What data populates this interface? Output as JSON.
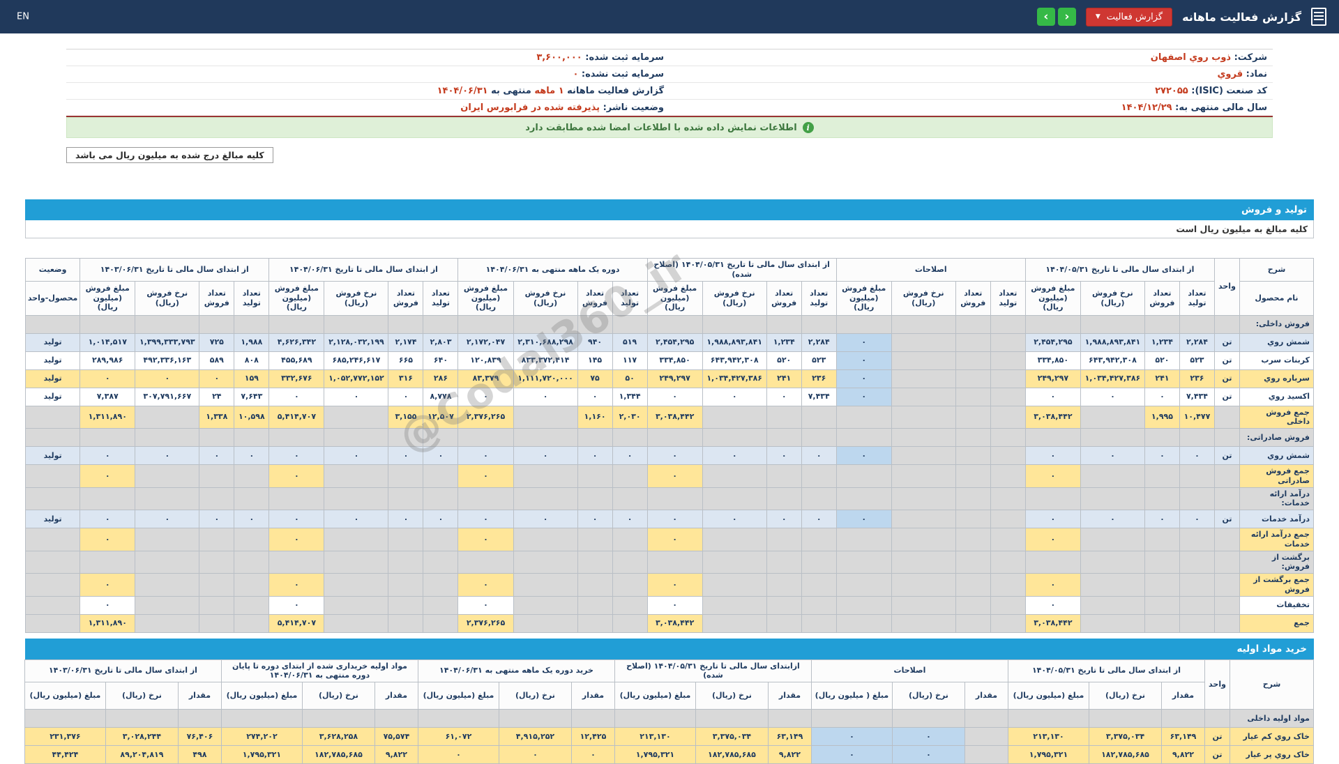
{
  "top_bar": {
    "title": "گزارش فعالیت ماهانه",
    "report_button_label": "گزارش فعالیت",
    "lang_toggle": "EN"
  },
  "info_banner": {
    "text": "اطلاعات نمایش داده شده با اطلاعات امضا شده مطابقت دارد",
    "icon": "info-circle"
  },
  "amounts_note_box": "کلیه مبالغ درج شده به میلیون ریال می باشد",
  "watermark": "@Codal360_ir",
  "colors": {
    "topbar": "#20395b",
    "accent_blue": "#219ed6",
    "accent_red": "#c43b1e",
    "row_blue": "#dce6f2",
    "row_yellow": "#ffe699",
    "row_gray": "#d9d9d9",
    "adjust_cell": "#bdd7ee",
    "success_bg": "#dff0d8",
    "button_red": "#cf3732",
    "button_green": "#35b947"
  },
  "company": {
    "rows": [
      {
        "right": [
          {
            "t": "شرکت: ",
            "c": "lbl"
          },
          {
            "t": "ذوب روي اصفهان",
            "c": "red"
          }
        ],
        "left": [
          {
            "t": "سرمایه ثبت شده: ",
            "c": "lbl"
          },
          {
            "t": "۳,۶۰۰,۰۰۰",
            "c": "red"
          }
        ]
      },
      {
        "right": [
          {
            "t": "نماد: ",
            "c": "lbl"
          },
          {
            "t": "قروي",
            "c": "red"
          }
        ],
        "left": [
          {
            "t": "سرمایه ثبت نشده: ",
            "c": "lbl"
          },
          {
            "t": "۰",
            "c": "red"
          }
        ]
      },
      {
        "right": [
          {
            "t": "کد صنعت (ISIC): ",
            "c": "lbl"
          },
          {
            "t": "۲۷۲۰۵۵",
            "c": "red"
          }
        ],
        "left": [
          {
            "t": "گزارش فعالیت ماهانه ",
            "c": "lbl"
          },
          {
            "t": "۱ ماهه",
            "c": "red"
          },
          {
            "t": " منتهی به ",
            "c": "lbl"
          },
          {
            "t": "۱۴۰۴/۰۶/۳۱",
            "c": "red"
          }
        ]
      },
      {
        "right": [
          {
            "t": "سال مالی منتهی به: ",
            "c": "lbl"
          },
          {
            "t": "۱۴۰۴/۱۲/۲۹",
            "c": "red"
          }
        ],
        "left": [
          {
            "t": "وضعیت ناشر: ",
            "c": "lbl"
          },
          {
            "t": "پذیرفته شده در فرابورس ایران",
            "c": "red"
          }
        ]
      }
    ]
  },
  "tables": [
    {
      "id": "production-sales",
      "bar_label": "تولید و فروش",
      "note": "کلیه مبالغ به میلیون ریال است",
      "header": {
        "sharh_top": "شرح",
        "sharh_sub": "نام محصول",
        "unit": "واحد",
        "status_top": "وضعیت",
        "status_sub": "محصول-واحد",
        "groups": [
          {
            "label": "از ابتدای سال مالی تا تاریخ ۱۴۰۴/۰۵/۳۱",
            "cols": [
              "تعداد تولید",
              "تعداد فروش",
              "نرخ فروش (ریال)",
              "مبلغ فروش (میلیون ریال)"
            ]
          },
          {
            "label": "اصلاحات",
            "cols": [
              "تعداد تولید",
              "تعداد فروش",
              "نرخ فروش (ریال)",
              "مبلغ فروش (میلیون ریال)"
            ]
          },
          {
            "label": "از ابتدای سال مالی تا تاریخ ۱۴۰۴/۰۵/۳۱ (اصلاح شده)",
            "cols": [
              "تعداد تولید",
              "تعداد فروش",
              "نرخ فروش (ریال)",
              "مبلغ فروش (میلیون ریال)"
            ]
          },
          {
            "label": "دوره یک ماهه منتهی به ۱۴۰۴/۰۶/۳۱",
            "cols": [
              "تعداد تولید",
              "تعداد فروش",
              "نرخ فروش (ریال)",
              "مبلغ فروش (میلیون ریال)"
            ]
          },
          {
            "label": "از ابتدای سال مالی تا تاریخ ۱۴۰۴/۰۶/۳۱",
            "cols": [
              "تعداد تولید",
              "تعداد فروش",
              "نرخ فروش (ریال)",
              "مبلغ فروش (میلیون ریال)"
            ]
          },
          {
            "label": "از ابتدای سال مالی تا تاریخ ۱۴۰۳/۰۶/۳۱",
            "cols": [
              "تعداد تولید",
              "تعداد فروش",
              "نرخ فروش (ریال)",
              "مبلغ فروش (میلیون ریال)"
            ]
          }
        ]
      },
      "rows": [
        {
          "type": "section",
          "label": "فروش داخلی:"
        },
        {
          "type": "data",
          "label": "شمش روي",
          "unit": "تن",
          "status": "تولید",
          "bg": "blue",
          "cells": [
            "۲,۲۸۴",
            "۱,۲۳۴",
            "۱,۹۸۸,۸۹۳,۸۴۱",
            "۲,۴۵۴,۲۹۵",
            "",
            "",
            "",
            "۰",
            "۲,۲۸۴",
            "۱,۲۳۴",
            "۱,۹۸۸,۸۹۳,۸۴۱",
            "۲,۴۵۴,۲۹۵",
            "۵۱۹",
            "۹۴۰",
            "۲,۳۱۰,۶۸۸,۲۹۸",
            "۲,۱۷۲,۰۴۷",
            "۲,۸۰۳",
            "۲,۱۷۴",
            "۲,۱۲۸,۰۳۲,۱۹۹",
            "۴,۶۲۶,۳۴۲",
            "۱,۹۸۸",
            "۷۲۵",
            "۱,۳۹۹,۳۳۳,۷۹۳",
            "۱,۰۱۴,۵۱۷"
          ]
        },
        {
          "type": "data",
          "label": "کربنات سرب",
          "unit": "تن",
          "status": "تولید",
          "bg": "white",
          "cells": [
            "۵۲۳",
            "۵۲۰",
            "۶۴۳,۹۴۲,۳۰۸",
            "۳۳۴,۸۵۰",
            "",
            "",
            "",
            "۰",
            "۵۲۳",
            "۵۲۰",
            "۶۴۳,۹۴۲,۳۰۸",
            "۳۳۴,۸۵۰",
            "۱۱۷",
            "۱۴۵",
            "۸۳۳,۳۷۲,۴۱۴",
            "۱۲۰,۸۳۹",
            "۶۴۰",
            "۶۶۵",
            "۶۸۵,۲۴۶,۶۱۷",
            "۴۵۵,۶۸۹",
            "۸۰۸",
            "۵۸۹",
            "۴۹۲,۳۳۶,۱۶۳",
            "۲۸۹,۹۸۶"
          ]
        },
        {
          "type": "data",
          "label": "سرباره روي",
          "unit": "تن",
          "status": "تولید",
          "bg": "yellow",
          "cells": [
            "۲۳۶",
            "۲۴۱",
            "۱,۰۳۴,۴۲۷,۳۸۶",
            "۲۴۹,۲۹۷",
            "",
            "",
            "",
            "۰",
            "۲۳۶",
            "۲۴۱",
            "۱,۰۳۴,۴۲۷,۳۸۶",
            "۲۴۹,۲۹۷",
            "۵۰",
            "۷۵",
            "۱,۱۱۱,۷۲۰,۰۰۰",
            "۸۳,۳۷۹",
            "۲۸۶",
            "۳۱۶",
            "۱,۰۵۲,۷۷۲,۱۵۲",
            "۳۳۲,۶۷۶",
            "۱۵۹",
            "۰",
            "۰",
            "۰"
          ]
        },
        {
          "type": "data",
          "label": "اکسید روي",
          "unit": "تن",
          "status": "تولید",
          "bg": "white",
          "cells": [
            "۷,۴۳۴",
            "۰",
            "۰",
            "۰",
            "",
            "",
            "",
            "۰",
            "۷,۴۳۴",
            "۰",
            "۰",
            "۰",
            "۱,۳۴۴",
            "۰",
            "۰",
            "۰",
            "۸,۷۷۸",
            "۰",
            "۰",
            "۰",
            "۷,۶۴۳",
            "۲۴",
            "۳۰۷,۷۹۱,۶۶۷",
            "۷,۳۸۷"
          ]
        },
        {
          "type": "sum",
          "label": "جمع فروش\nداخلی",
          "unit": "",
          "status": "",
          "bg": "yellow",
          "cells": [
            "۱۰,۴۷۷",
            "۱,۹۹۵",
            "",
            "۳,۰۳۸,۴۴۲",
            "",
            "",
            "",
            "",
            "",
            "",
            "",
            "۳,۰۳۸,۴۴۲",
            "۲,۰۳۰",
            "۱,۱۶۰",
            "",
            "۲,۳۷۶,۲۶۵",
            "۱۲,۵۰۷",
            "۳,۱۵۵",
            "",
            "۵,۴۱۴,۷۰۷",
            "۱۰,۵۹۸",
            "۱,۳۳۸",
            "",
            "۱,۳۱۱,۸۹۰"
          ]
        },
        {
          "type": "section",
          "label": "فروش صادراتی:"
        },
        {
          "type": "data",
          "label": "شمش روي",
          "unit": "تن",
          "status": "تولید",
          "bg": "blue",
          "cells": [
            "۰",
            "۰",
            "۰",
            "۰",
            "",
            "",
            "",
            "۰",
            "۰",
            "۰",
            "۰",
            "۰",
            "۰",
            "۰",
            "۰",
            "۰",
            "۰",
            "۰",
            "۰",
            "۰",
            "۰",
            "۰",
            "۰",
            "۰"
          ]
        },
        {
          "type": "sum",
          "label": "جمع فروش\nصادراتی",
          "unit": "",
          "status": "",
          "bg": "yellow",
          "cells": [
            "",
            "",
            "",
            "۰",
            "",
            "",
            "",
            "",
            "",
            "",
            "",
            "۰",
            "",
            "",
            "",
            "۰",
            "",
            "",
            "",
            "۰",
            "",
            "",
            "",
            "۰"
          ]
        },
        {
          "type": "section",
          "label": "درآمد ارائه\nخدمات:"
        },
        {
          "type": "data",
          "label": "درآمد خدمات",
          "unit": "تن",
          "status": "تولید",
          "bg": "blue",
          "cells": [
            "۰",
            "۰",
            "۰",
            "۰",
            "",
            "",
            "",
            "۰",
            "۰",
            "۰",
            "۰",
            "۰",
            "۰",
            "۰",
            "۰",
            "۰",
            "۰",
            "۰",
            "۰",
            "۰",
            "۰",
            "۰",
            "۰",
            "۰"
          ]
        },
        {
          "type": "sum",
          "label": "جمع درآمد ارائه\nخدمات",
          "unit": "",
          "status": "",
          "bg": "yellow",
          "cells": [
            "",
            "",
            "",
            "۰",
            "",
            "",
            "",
            "",
            "",
            "",
            "",
            "۰",
            "",
            "",
            "",
            "۰",
            "",
            "",
            "",
            "۰",
            "",
            "",
            "",
            "۰"
          ]
        },
        {
          "type": "section",
          "label": "برگشت از\nفروش:"
        },
        {
          "type": "sum",
          "label": "جمع برگشت از\nفروش",
          "unit": "",
          "status": "",
          "bg": "yellow",
          "cells": [
            "",
            "",
            "",
            "۰",
            "",
            "",
            "",
            "",
            "",
            "",
            "",
            "۰",
            "",
            "",
            "",
            "۰",
            "",
            "",
            "",
            "۰",
            "",
            "",
            "",
            "۰"
          ]
        },
        {
          "type": "data",
          "label": "تخفیفات",
          "unit": "",
          "status": "",
          "bg": "white",
          "cells": [
            "",
            "",
            "",
            "۰",
            "",
            "",
            "",
            "",
            "",
            "",
            "",
            "۰",
            "",
            "",
            "",
            "۰",
            "",
            "",
            "",
            "۰",
            "",
            "",
            "",
            "۰"
          ]
        },
        {
          "type": "sum",
          "label": "جمع",
          "unit": "",
          "status": "",
          "bg": "yellow",
          "cells": [
            "",
            "",
            "",
            "۳,۰۳۸,۴۴۲",
            "",
            "",
            "",
            "",
            "",
            "",
            "",
            "۳,۰۳۸,۴۴۲",
            "",
            "",
            "",
            "۲,۳۷۶,۲۶۵",
            "",
            "",
            "",
            "۵,۴۱۴,۷۰۷",
            "",
            "",
            "",
            "۱,۳۱۱,۸۹۰"
          ]
        }
      ]
    },
    {
      "id": "raw-materials",
      "bar_label": "خرید مواد اولیه",
      "header": {
        "sharh_top": "شرح",
        "sharh_sub": null,
        "unit": "واحد",
        "groups": [
          {
            "label": "از ابتدای سال مالی تا تاریخ ۱۴۰۴/۰۵/۳۱",
            "cols": [
              "مقدار",
              "نرخ (ریال)",
              "مبلغ (میلیون ریال)"
            ]
          },
          {
            "label": "اصلاحات",
            "cols": [
              "مقدار",
              "نرخ (ریال)",
              "مبلغ ( میلیون ریال)"
            ]
          },
          {
            "label": "ازابتدای سال مالی تا تاریخ ۱۴۰۴/۰۵/۳۱ (اصلاح شده)",
            "cols": [
              "مقدار",
              "نرخ (ریال)",
              "مبلغ (میلیون ریال)"
            ]
          },
          {
            "label": "خرید دوره یک ماهه منتهی به ۱۴۰۴/۰۶/۳۱",
            "cols": [
              "مقدار",
              "نرخ (ریال)",
              "مبلغ (میلیون ریال)"
            ]
          },
          {
            "label": "مواد اولیه خریداری شده از ابتدای دوره تا پایان دوره منتهی به ۱۴۰۴/۰۶/۳۱",
            "cols": [
              "مقدار",
              "نرخ (ریال)",
              "مبلغ (میلیون ریال)"
            ]
          },
          {
            "label": "از ابتدای سال مالی تا تاریخ ۱۴۰۳/۰۶/۳۱",
            "cols": [
              "مقدار",
              "نرخ (ریال)",
              "مبلغ (میلیون ریال)"
            ]
          }
        ]
      },
      "rows": [
        {
          "type": "section",
          "label": "مواد اولیه داخلی"
        },
        {
          "type": "data",
          "label": "خاک روي کم عیار",
          "unit": "تن",
          "bg": "yellow",
          "cells": [
            "۶۳,۱۴۹",
            "۳,۳۷۵,۰۳۴",
            "۲۱۳,۱۳۰",
            "",
            "۰",
            "۰",
            "۶۳,۱۴۹",
            "۳,۳۷۵,۰۳۴",
            "۲۱۳,۱۳۰",
            "۱۲,۴۲۵",
            "۴,۹۱۵,۲۵۲",
            "۶۱,۰۷۲",
            "۷۵,۵۷۴",
            "۳,۶۲۸,۲۵۸",
            "۲۷۴,۲۰۲",
            "۷۶,۴۰۶",
            "۳,۰۲۸,۲۴۴",
            "۲۳۱,۳۷۶"
          ]
        },
        {
          "type": "data",
          "label": "خاک روي پر عیار",
          "unit": "تن",
          "bg": "yellow",
          "cells": [
            "۹,۸۲۲",
            "۱۸۲,۷۸۵,۶۸۵",
            "۱,۷۹۵,۳۲۱",
            "",
            "۰",
            "۰",
            "۹,۸۲۲",
            "۱۸۲,۷۸۵,۶۸۵",
            "۱,۷۹۵,۳۲۱",
            "۰",
            "۰",
            "۰",
            "۹,۸۲۲",
            "۱۸۲,۷۸۵,۶۸۵",
            "۱,۷۹۵,۳۲۱",
            "۴۹۸",
            "۸۹,۲۰۴,۸۱۹",
            "۴۴,۴۲۴"
          ]
        }
      ]
    }
  ]
}
